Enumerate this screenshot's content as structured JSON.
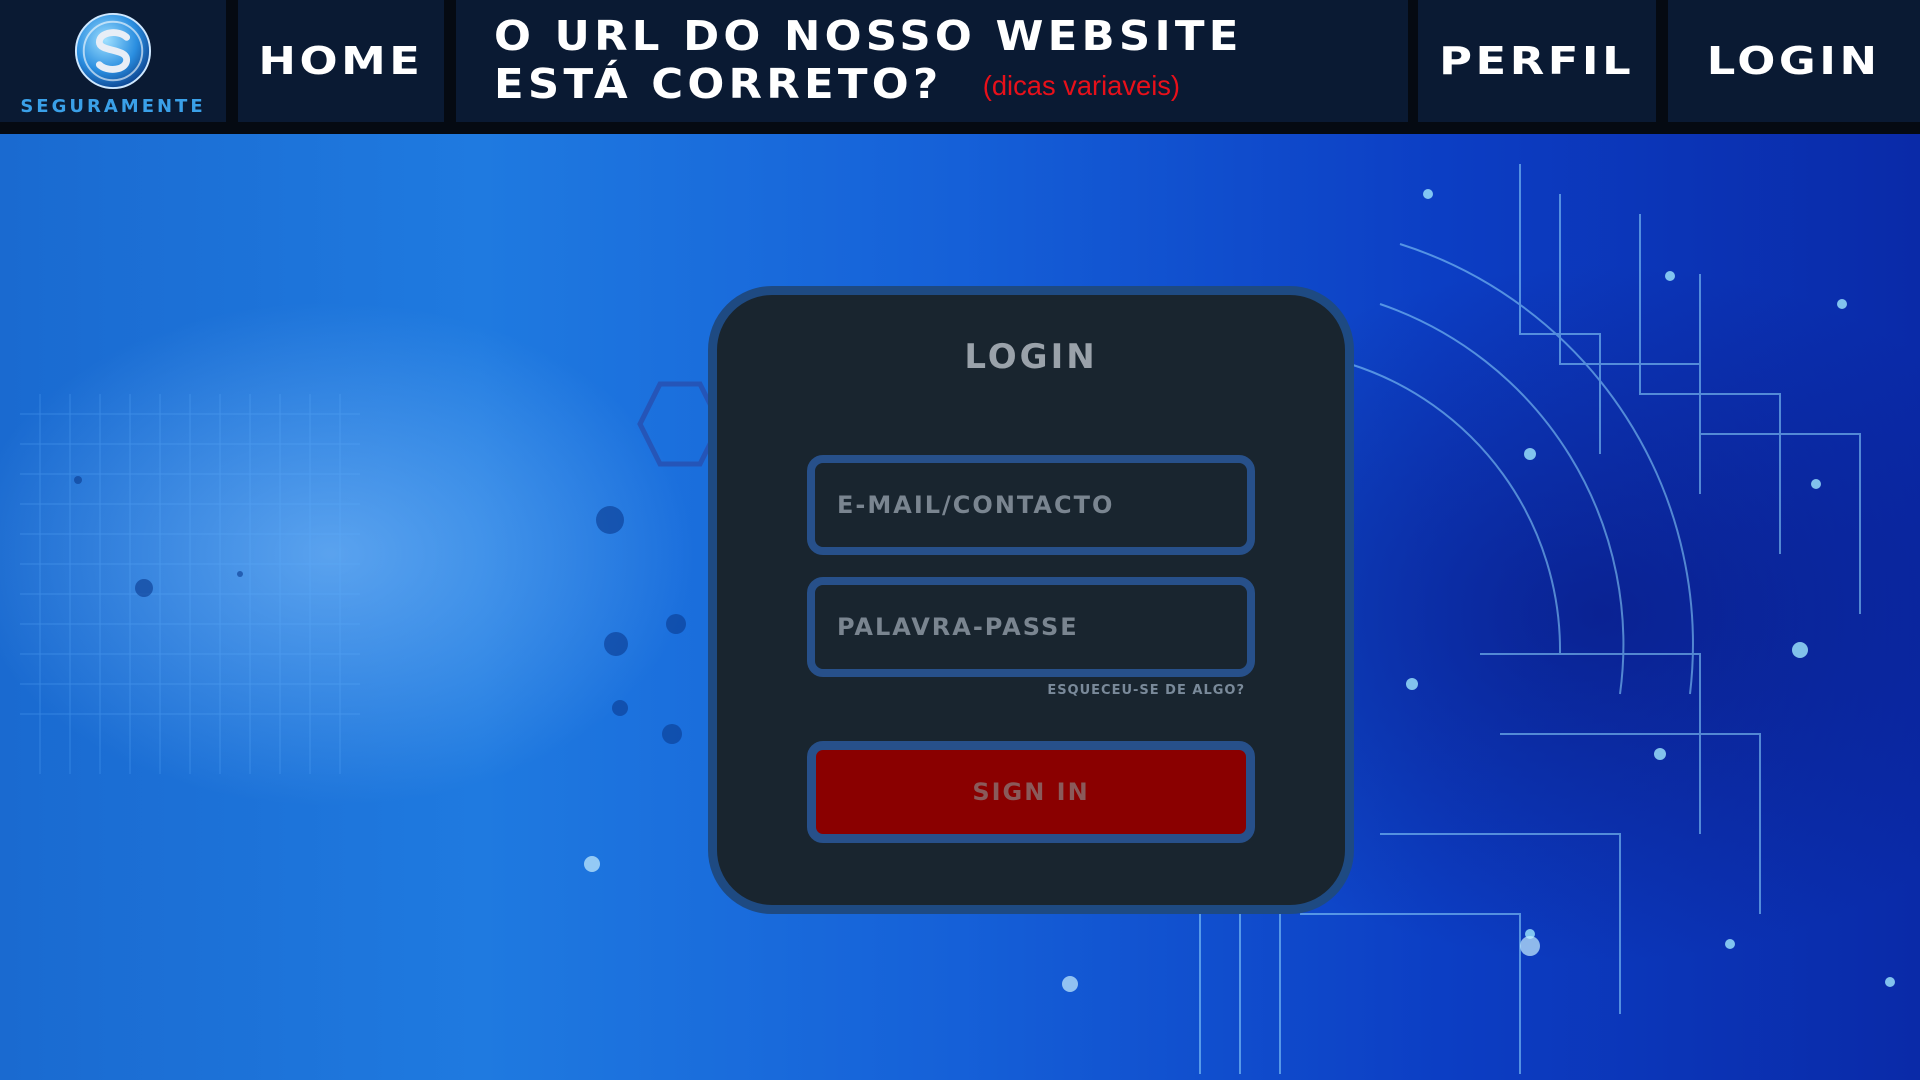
{
  "brand": {
    "name": "SEGURAMENTE",
    "logo_icon": "shield-s-logo-icon",
    "color": "#3aa0e8"
  },
  "nav": {
    "home_label": "HOME",
    "url_question_line1": "O URL DO NOSSO WEBSITE",
    "url_question_line2": "ESTÁ CORRETO?",
    "hint_label": "(dicas variaveis)",
    "perfil_label": "PERFIL",
    "login_label": "LOGIN"
  },
  "login_card": {
    "title": "LOGIN",
    "email_placeholder": "E-MAIL/CONTACTO",
    "password_placeholder": "PALAVRA-PASSE",
    "forgot_link": "ESQUECEU-SE DE ALGO?",
    "sign_in_label": "SIGN IN"
  },
  "colors": {
    "header_bg": "#0a1a33",
    "card_bg": "#19252f",
    "card_border": "#1e4a82",
    "signin_bg": "#8a0000",
    "hint_red": "#e8101a"
  }
}
